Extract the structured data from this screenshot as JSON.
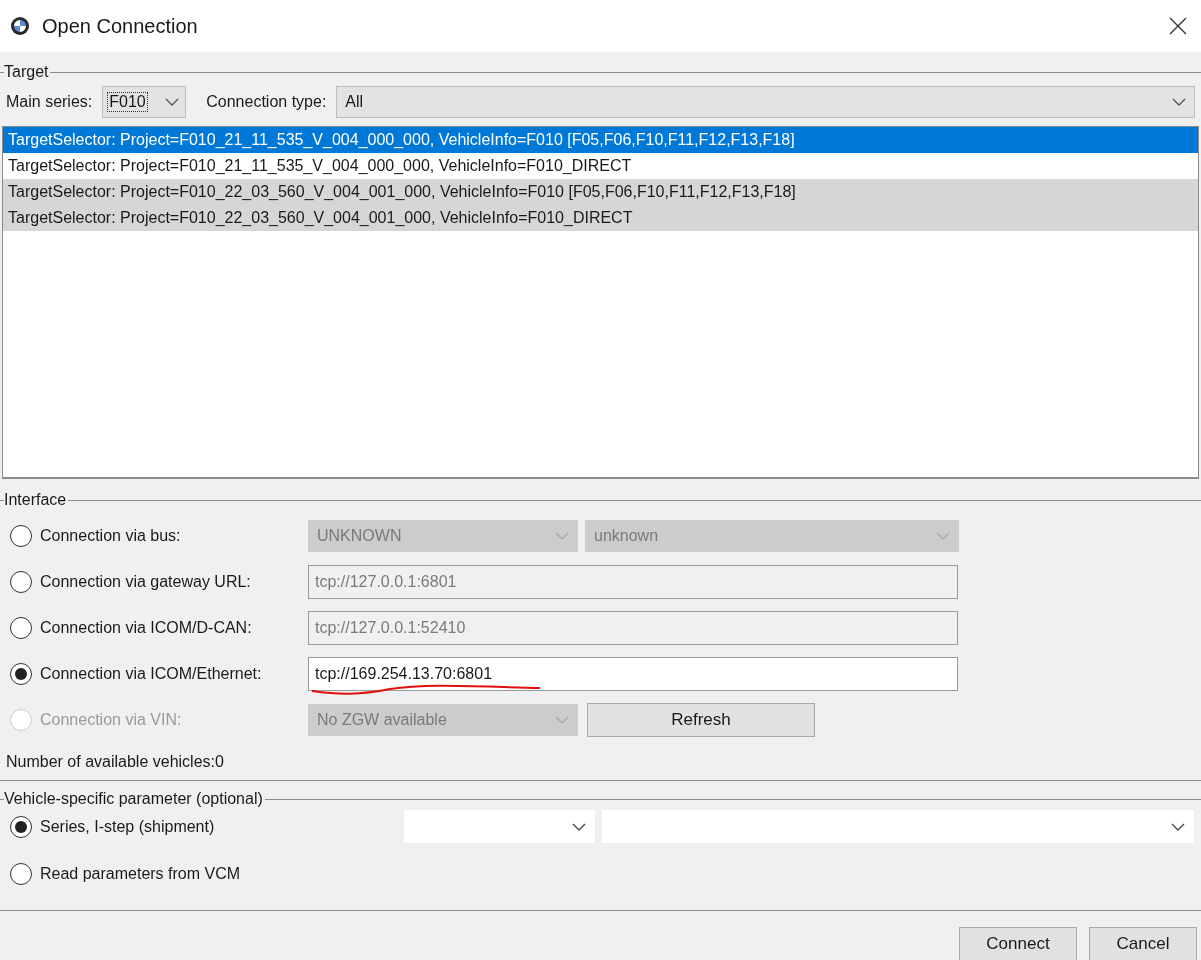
{
  "window": {
    "title": "Open Connection"
  },
  "target": {
    "legend": "Target",
    "main_series_label": "Main series:",
    "main_series": "F010",
    "connection_type_label": "Connection type:",
    "connection_type": "All",
    "rows": [
      {
        "text": "TargetSelector: Project=F010_21_11_535_V_004_000_000, VehicleInfo=F010 [F05,F06,F10,F11,F12,F13,F18]",
        "selected": true,
        "shaded": false
      },
      {
        "text": "TargetSelector: Project=F010_21_11_535_V_004_000_000, VehicleInfo=F010_DIRECT",
        "selected": false,
        "shaded": false
      },
      {
        "text": "TargetSelector: Project=F010_22_03_560_V_004_001_000, VehicleInfo=F010 [F05,F06,F10,F11,F12,F13,F18]",
        "selected": false,
        "shaded": true
      },
      {
        "text": "TargetSelector: Project=F010_22_03_560_V_004_001_000, VehicleInfo=F010_DIRECT",
        "selected": false,
        "shaded": true
      }
    ]
  },
  "interface": {
    "legend": "Interface",
    "options": [
      {
        "label": "Connection via bus:",
        "selected": false,
        "disabled": false,
        "controls": [
          {
            "kind": "dropdown",
            "value": "UNKNOWN",
            "disabled": true
          },
          {
            "kind": "dropdown",
            "value": "unknown",
            "disabled": true
          }
        ]
      },
      {
        "label": "Connection via gateway URL:",
        "selected": false,
        "disabled": false,
        "controls": [
          {
            "kind": "field",
            "value": "tcp://127.0.0.1:6801",
            "disabled": true
          }
        ]
      },
      {
        "label": "Connection via ICOM/D-CAN:",
        "selected": false,
        "disabled": false,
        "controls": [
          {
            "kind": "field",
            "value": "tcp://127.0.0.1:52410",
            "disabled": true
          }
        ]
      },
      {
        "label": "Connection via ICOM/Ethernet:",
        "selected": true,
        "disabled": false,
        "controls": [
          {
            "kind": "field",
            "value": "tcp://169.254.13.70:6801",
            "disabled": false,
            "underlined": true
          }
        ]
      },
      {
        "label": "Connection via VIN:",
        "selected": false,
        "disabled": true,
        "controls": [
          {
            "kind": "dropdown",
            "value": "No ZGW available",
            "disabled": true
          },
          {
            "kind": "button",
            "label": "Refresh"
          }
        ]
      }
    ],
    "count_label": "Number of available vehicles:0"
  },
  "vehicle": {
    "legend": "Vehicle-specific parameter (optional)",
    "options": [
      {
        "label": "Series, I-step (shipment)",
        "selected": true,
        "disabled": false,
        "controls": [
          {
            "kind": "dropdown",
            "disabled": false
          },
          {
            "kind": "dropdown",
            "disabled": false
          }
        ]
      },
      {
        "label": "Read parameters from VCM",
        "selected": false,
        "disabled": false
      }
    ]
  },
  "buttons": [
    "Connect",
    "Cancel"
  ]
}
